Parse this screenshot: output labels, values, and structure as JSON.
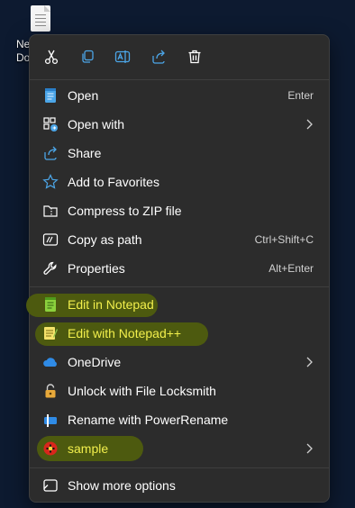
{
  "desktop": {
    "file_label_line1": "Ne",
    "file_label_line2": "Do"
  },
  "toolbar": {
    "buttons": [
      {
        "icon": "scissors-icon",
        "name": "cut"
      },
      {
        "icon": "copy-icon",
        "name": "copy"
      },
      {
        "icon": "rename-icon",
        "name": "rename"
      },
      {
        "icon": "share-icon",
        "name": "share"
      },
      {
        "icon": "trash-icon",
        "name": "delete"
      }
    ]
  },
  "menu": {
    "items": [
      {
        "label": "Open",
        "shortcut": "Enter",
        "icon": "notepad-icon"
      },
      {
        "label": "Open with",
        "shortcut": "",
        "submenu": true,
        "icon": "open-with-icon"
      },
      {
        "label": "Share",
        "shortcut": "",
        "icon": "share-icon"
      },
      {
        "label": "Add to Favorites",
        "shortcut": "",
        "icon": "star-icon"
      },
      {
        "label": "Compress to ZIP file",
        "shortcut": "",
        "icon": "zip-folder-icon"
      },
      {
        "label": "Copy as path",
        "shortcut": "Ctrl+Shift+C",
        "icon": "copy-path-icon"
      },
      {
        "label": "Properties",
        "shortcut": "Alt+Enter",
        "icon": "wrench-icon"
      },
      {
        "label": "Edit in Notepad",
        "shortcut": "",
        "icon": "notepad-green-icon",
        "highlighted": true
      },
      {
        "label": "Edit with Notepad++",
        "shortcut": "",
        "icon": "notepadpp-icon",
        "highlighted": true
      },
      {
        "label": "OneDrive",
        "shortcut": "",
        "submenu": true,
        "icon": "cloud-icon"
      },
      {
        "label": "Unlock with File Locksmith",
        "shortcut": "",
        "icon": "lock-icon"
      },
      {
        "label": "Rename with PowerRename",
        "shortcut": "",
        "icon": "powerrename-icon"
      },
      {
        "label": "sample",
        "shortcut": "",
        "submenu": true,
        "icon": "sample-app-icon",
        "highlighted": true
      },
      {
        "label": "Show more options",
        "shortcut": "",
        "icon": "more-options-icon"
      }
    ]
  },
  "colors": {
    "menu_bg": "#2c2c2c",
    "accent_blue": "#4ca6e8",
    "highlight": "#4d5a0f",
    "highlight_text": "#f2ef4c"
  }
}
